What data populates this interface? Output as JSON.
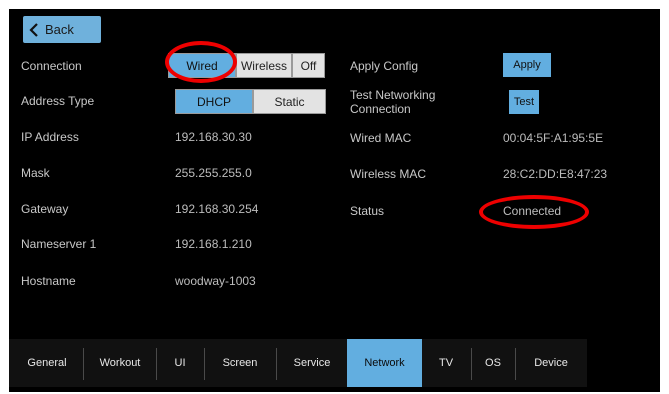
{
  "back": {
    "label": "Back"
  },
  "left": {
    "connection_label": "Connection",
    "connection_options": [
      "Wired",
      "Wireless",
      "Off"
    ],
    "address_type_label": "Address Type",
    "address_type_options": [
      "DHCP",
      "Static"
    ],
    "ip_label": "IP Address",
    "ip_value": "192.168.30.30",
    "mask_label": "Mask",
    "mask_value": "255.255.255.0",
    "gateway_label": "Gateway",
    "gateway_value": "192.168.30.254",
    "ns_label": "Nameserver 1",
    "ns_value": "192.168.1.210",
    "host_label": "Hostname",
    "host_value": "woodway-1003"
  },
  "right": {
    "apply_config_label": "Apply Config",
    "apply_button": "Apply",
    "test_label_1": "Test Networking",
    "test_label_2": "Connection",
    "test_button": "Test",
    "wired_mac_label": "Wired MAC",
    "wired_mac_value": "00:04:5F:A1:95:5E",
    "wireless_mac_label": "Wireless MAC",
    "wireless_mac_value": "28:C2:DD:E8:47:23",
    "status_label": "Status",
    "status_value": "Connected"
  },
  "tabs": [
    "General",
    "Workout",
    "UI",
    "Screen",
    "Service",
    "Network",
    "TV",
    "OS",
    "Device"
  ],
  "selected_tab": "Network",
  "colors": {
    "accent": "#62aee0",
    "annotation": "#e00000",
    "background": "#000000"
  }
}
